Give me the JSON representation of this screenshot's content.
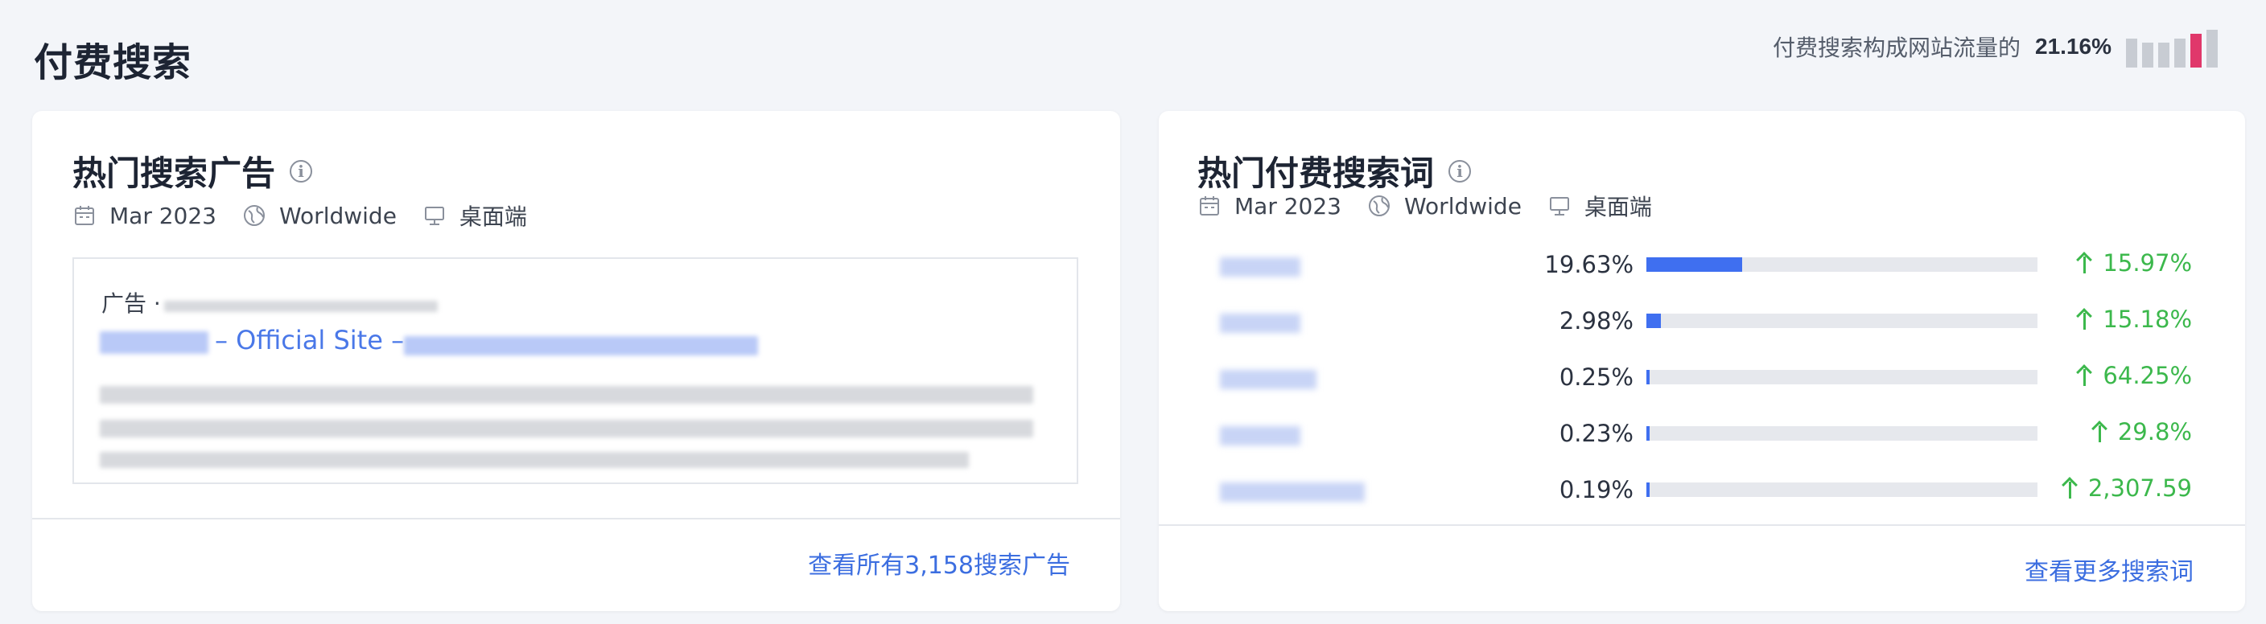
{
  "page": {
    "title": "付费搜索",
    "share_text": "付费搜索构成网站流量的",
    "share_value": "21.16%",
    "share_bar_levels": [
      0.7,
      0.6,
      0.6,
      0.7,
      0.8,
      0.9
    ],
    "share_highlight_index": 4,
    "accent_pink": "#e0386b"
  },
  "left_card": {
    "title": "热门搜索广告",
    "info_icon": "info-icon",
    "date": "Mar 2023",
    "region": "Worldwide",
    "device": "桌面端",
    "ad": {
      "label": "广告 ·",
      "link_text": "– Official Site –"
    },
    "footer_link": "查看所有3,158搜索广告"
  },
  "right_card": {
    "title": "热门付费搜索词",
    "info_icon": "info-icon",
    "date": "Mar 2023",
    "region": "Worldwide",
    "device": "桌面端",
    "keywords": [
      {
        "share": "19.63%",
        "share_fraction": 0.1963,
        "change": "15.97%"
      },
      {
        "share": "2.98%",
        "share_fraction": 0.0298,
        "change": "15.18%"
      },
      {
        "share": "0.25%",
        "share_fraction": 0.0025,
        "change": "64.25%"
      },
      {
        "share": "0.23%",
        "share_fraction": 0.0023,
        "change": "29.8%"
      },
      {
        "share": "0.19%",
        "share_fraction": 0.0019,
        "change": "2,307.59"
      }
    ],
    "footer_link": "查看更多搜索词",
    "bar_color": "#3f6ff0",
    "positive_color": "#3cb84c"
  }
}
